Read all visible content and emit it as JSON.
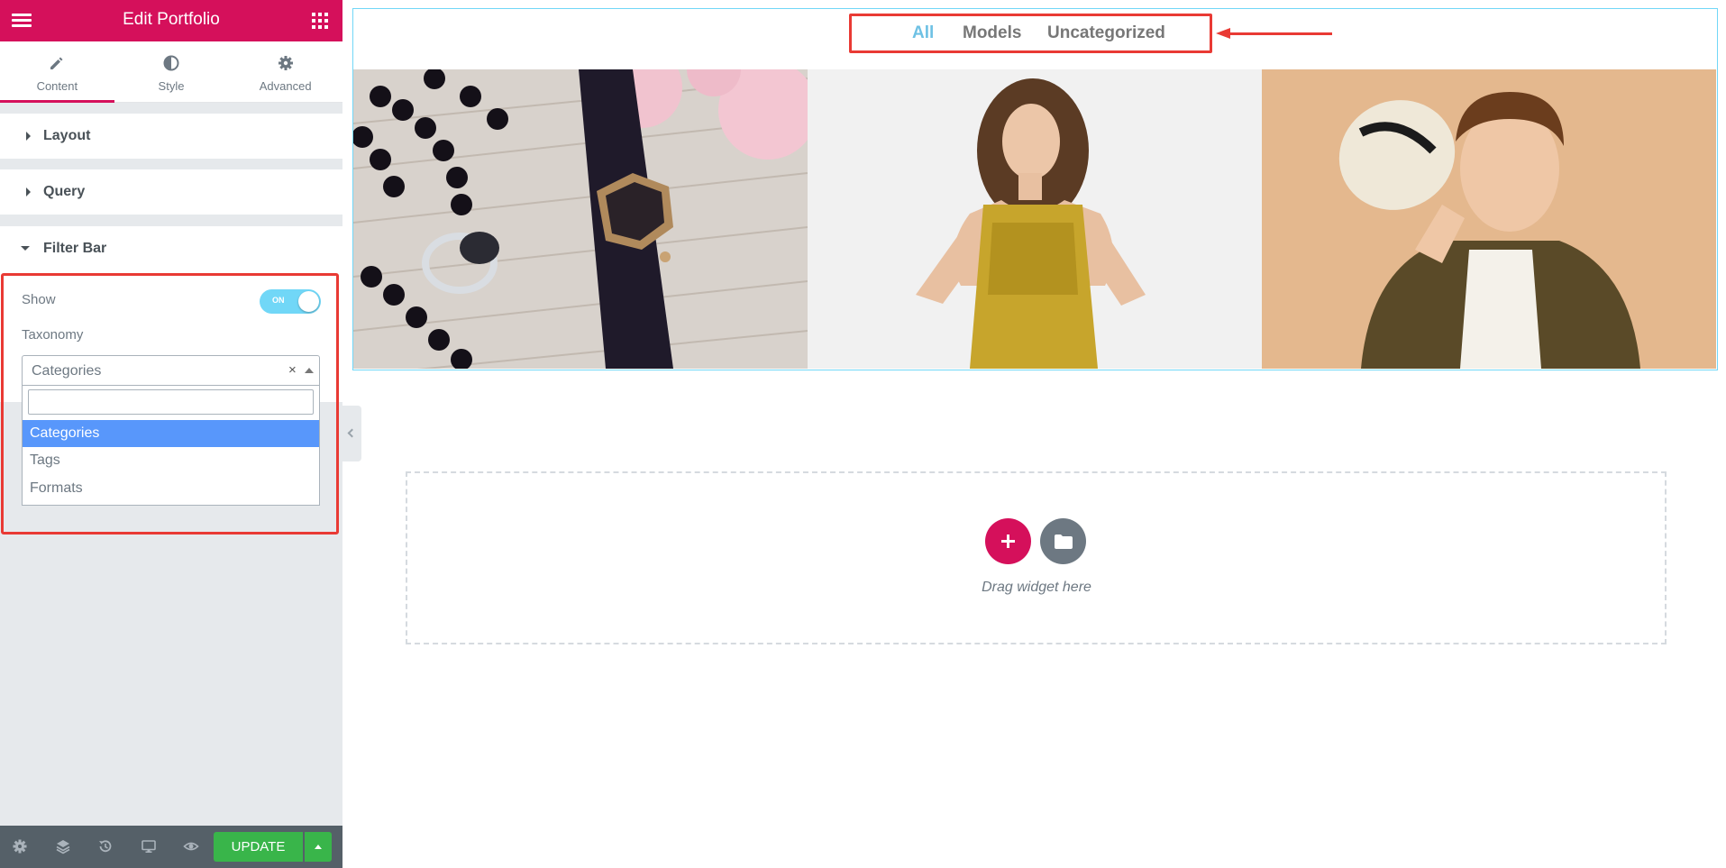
{
  "header": {
    "title": "Edit Portfolio"
  },
  "tabs": [
    {
      "label": "Content",
      "icon": "pencil-icon",
      "active": true
    },
    {
      "label": "Style",
      "icon": "half-circle-icon"
    },
    {
      "label": "Advanced",
      "icon": "gear-icon"
    }
  ],
  "sections": {
    "layout": "Layout",
    "query": "Query",
    "filter_bar": "Filter Bar"
  },
  "filter_bar": {
    "show_label": "Show",
    "show_toggle": "ON",
    "taxonomy_label": "Taxonomy",
    "taxonomy_value": "Categories",
    "clear_symbol": "×",
    "search_value": "",
    "options": [
      "Categories",
      "Tags",
      "Formats"
    ]
  },
  "footer": {
    "update_label": "UPDATE"
  },
  "portfolio": {
    "filters": [
      "All",
      "Models",
      "Uncategorized"
    ],
    "active_filter": "All"
  },
  "dropzone": {
    "text": "Drag widget here"
  },
  "colors": {
    "brand": "#d5105b",
    "accent": "#6ec1e4",
    "highlight": "#e93a34",
    "update": "#39b54a"
  }
}
